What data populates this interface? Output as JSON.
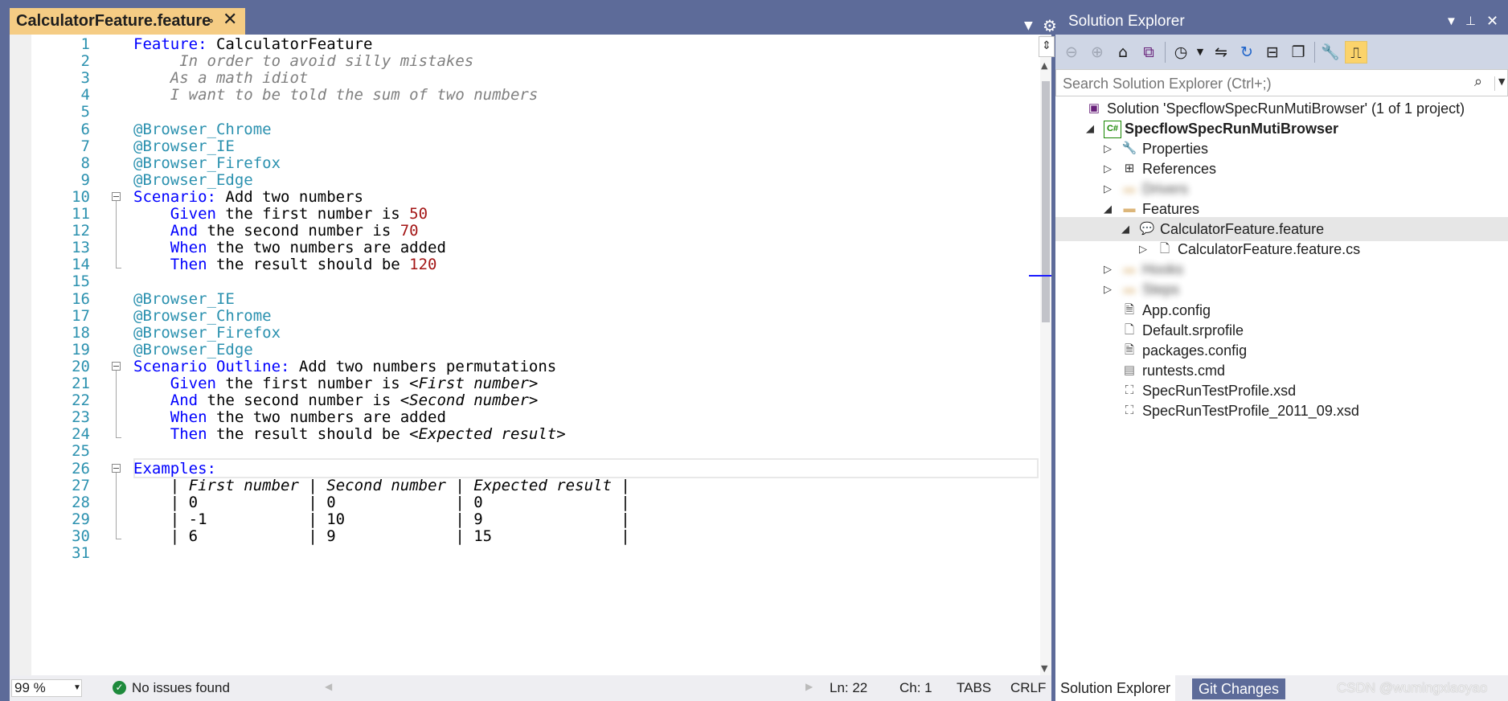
{
  "editor": {
    "tab_title": "CalculatorFeature.feature",
    "pin_glyph": "⊸",
    "close_glyph": "✕",
    "lines": [
      {
        "n": "1",
        "segs": [
          [
            "c-kw",
            "Feature: "
          ],
          [
            "c-plain",
            "CalculatorFeature"
          ]
        ]
      },
      {
        "n": "2",
        "segs": [
          [
            "c-desc",
            "     In order to avoid silly mistakes"
          ]
        ]
      },
      {
        "n": "3",
        "segs": [
          [
            "c-desc",
            "    As a math idiot"
          ]
        ]
      },
      {
        "n": "4",
        "segs": [
          [
            "c-desc",
            "    I want to be told the sum of two numbers"
          ]
        ]
      },
      {
        "n": "5",
        "segs": []
      },
      {
        "n": "6",
        "segs": [
          [
            "c-tag",
            "@Browser_Chrome"
          ]
        ]
      },
      {
        "n": "7",
        "segs": [
          [
            "c-tag",
            "@Browser_IE"
          ]
        ]
      },
      {
        "n": "8",
        "segs": [
          [
            "c-tag",
            "@Browser_Firefox"
          ]
        ]
      },
      {
        "n": "9",
        "segs": [
          [
            "c-tag",
            "@Browser_Edge"
          ]
        ]
      },
      {
        "n": "10",
        "fold": true,
        "segs": [
          [
            "c-kw",
            "Scenario: "
          ],
          [
            "c-plain",
            "Add two numbers"
          ]
        ]
      },
      {
        "n": "11",
        "segs": [
          [
            "c-kw",
            "    Given "
          ],
          [
            "c-plain",
            "the first number is "
          ],
          [
            "c-num",
            "50"
          ]
        ]
      },
      {
        "n": "12",
        "segs": [
          [
            "c-kw",
            "    And "
          ],
          [
            "c-plain",
            "the second number is "
          ],
          [
            "c-num",
            "70"
          ]
        ]
      },
      {
        "n": "13",
        "segs": [
          [
            "c-kw",
            "    When "
          ],
          [
            "c-plain",
            "the two numbers are added"
          ]
        ]
      },
      {
        "n": "14",
        "segs": [
          [
            "c-kw",
            "    Then "
          ],
          [
            "c-plain",
            "the result should be "
          ],
          [
            "c-num",
            "120"
          ]
        ]
      },
      {
        "n": "15",
        "segs": []
      },
      {
        "n": "16",
        "segs": [
          [
            "c-tag",
            "@Browser_IE"
          ]
        ]
      },
      {
        "n": "17",
        "segs": [
          [
            "c-tag",
            "@Browser_Chrome"
          ]
        ]
      },
      {
        "n": "18",
        "segs": [
          [
            "c-tag",
            "@Browser_Firefox"
          ]
        ]
      },
      {
        "n": "19",
        "segs": [
          [
            "c-tag",
            "@Browser_Edge"
          ]
        ]
      },
      {
        "n": "20",
        "fold": true,
        "segs": [
          [
            "c-kw",
            "Scenario Outline: "
          ],
          [
            "c-plain",
            "Add two numbers permutations"
          ]
        ]
      },
      {
        "n": "21",
        "segs": [
          [
            "c-kw",
            "    Given "
          ],
          [
            "c-plain",
            "the first number is "
          ],
          [
            "c-param",
            "<First number>"
          ]
        ]
      },
      {
        "n": "22",
        "segs": [
          [
            "c-kw",
            "    And "
          ],
          [
            "c-plain",
            "the second number is "
          ],
          [
            "c-param",
            "<Second number>"
          ]
        ]
      },
      {
        "n": "23",
        "segs": [
          [
            "c-kw",
            "    When "
          ],
          [
            "c-plain",
            "the two numbers are added"
          ]
        ]
      },
      {
        "n": "24",
        "segs": [
          [
            "c-kw",
            "    Then "
          ],
          [
            "c-plain",
            "the result should be "
          ],
          [
            "c-param",
            "<Expected result>"
          ]
        ]
      },
      {
        "n": "25",
        "segs": []
      },
      {
        "n": "26",
        "fold": true,
        "segs": [
          [
            "c-kw",
            "Examples:"
          ]
        ]
      },
      {
        "n": "27",
        "segs": [
          [
            "c-plain",
            "    | "
          ],
          [
            "c-param",
            "First number"
          ],
          [
            "c-plain",
            " | "
          ],
          [
            "c-param",
            "Second number"
          ],
          [
            "c-plain",
            " | "
          ],
          [
            "c-param",
            "Expected result"
          ],
          [
            "c-plain",
            " |"
          ]
        ]
      },
      {
        "n": "28",
        "segs": [
          [
            "c-plain",
            "    | 0            | 0             | 0               |"
          ]
        ]
      },
      {
        "n": "29",
        "segs": [
          [
            "c-plain",
            "    | -1           | 10            | 9               |"
          ]
        ]
      },
      {
        "n": "30",
        "segs": [
          [
            "c-plain",
            "    | 6            | 9             | 15              |"
          ]
        ]
      },
      {
        "n": "31",
        "segs": []
      }
    ]
  },
  "status": {
    "zoom": "99 %",
    "issues": "No issues found",
    "line": "Ln: 22",
    "col": "Ch: 1",
    "indent": "TABS",
    "eol": "CRLF"
  },
  "solution_explorer": {
    "title": "Solution Explorer",
    "search_placeholder": "Search Solution Explorer (Ctrl+;)",
    "tree": [
      {
        "label": "Solution 'SpecflowSpecRunMutiBrowser' (1 of 1 project)",
        "indent": 0,
        "exp": "",
        "icon": "solution-icon",
        "glyph": "▣",
        "color": "#68217a"
      },
      {
        "label": "SpecflowSpecRunMutiBrowser",
        "indent": 1,
        "exp": "◢",
        "icon": "csharp-project-icon",
        "glyph": "C#",
        "color": "#178600",
        "bold": true
      },
      {
        "label": "Properties",
        "indent": 2,
        "exp": "▷",
        "icon": "wrench-icon",
        "glyph": "🔧",
        "color": "#333"
      },
      {
        "label": "References",
        "indent": 2,
        "exp": "▷",
        "icon": "references-icon",
        "glyph": "⊞",
        "color": "#333"
      },
      {
        "label": "Drivers",
        "indent": 2,
        "exp": "▷",
        "icon": "folder-icon",
        "glyph": "▬",
        "color": "#dcb67a",
        "blur": true
      },
      {
        "label": "Features",
        "indent": 2,
        "exp": "◢",
        "icon": "folder-open-icon",
        "glyph": "▬",
        "color": "#dcb67a"
      },
      {
        "label": "CalculatorFeature.feature",
        "indent": 3,
        "exp": "◢",
        "icon": "feature-file-icon",
        "glyph": "💬",
        "color": "#5ab000",
        "selected": true
      },
      {
        "label": "CalculatorFeature.feature.cs",
        "indent": 4,
        "exp": "▷",
        "icon": "cs-file-icon",
        "glyph": "🗋",
        "color": "#333"
      },
      {
        "label": "Hooks",
        "indent": 2,
        "exp": "▷",
        "icon": "folder-icon",
        "glyph": "▬",
        "color": "#dcb67a",
        "blur": true
      },
      {
        "label": "Steps",
        "indent": 2,
        "exp": "▷",
        "icon": "folder-icon",
        "glyph": "▬",
        "color": "#dcb67a",
        "blur": true
      },
      {
        "label": "App.config",
        "indent": 2,
        "exp": "",
        "icon": "config-file-icon",
        "glyph": "🗎",
        "color": "#333"
      },
      {
        "label": "Default.srprofile",
        "indent": 2,
        "exp": "",
        "icon": "file-icon",
        "glyph": "🗋",
        "color": "#333"
      },
      {
        "label": "packages.config",
        "indent": 2,
        "exp": "",
        "icon": "config-file-icon",
        "glyph": "🗎",
        "color": "#333"
      },
      {
        "label": "runtests.cmd",
        "indent": 2,
        "exp": "",
        "icon": "cmd-file-icon",
        "glyph": "▤",
        "color": "#777"
      },
      {
        "label": "SpecRunTestProfile.xsd",
        "indent": 2,
        "exp": "",
        "icon": "xsd-file-icon",
        "glyph": "⛶",
        "color": "#555"
      },
      {
        "label": "SpecRunTestProfile_2011_09.xsd",
        "indent": 2,
        "exp": "",
        "icon": "xsd-file-icon",
        "glyph": "⛶",
        "color": "#555"
      }
    ],
    "tabs": {
      "solution": "Solution Explorer",
      "git": "Git Changes"
    },
    "watermark": "CSDN @wumingxiaoyao"
  }
}
